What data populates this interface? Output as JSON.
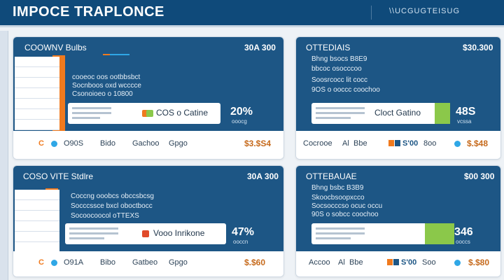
{
  "app": {
    "title": "IMPOCE TRAPLONCE",
    "right_label": "\\\\UCGUGTEISUG"
  },
  "cards": [
    {
      "title": "COOWNV Bulbs",
      "value": "30A 300",
      "lines": [
        "cooeoc oos ootbbsbct",
        "Socnboos oxd wcccce",
        "Csonoioeo o 10800"
      ],
      "inner_label": "COS o Catine",
      "pct": "20%",
      "pct_sub": "ooocg",
      "footer": [
        "C",
        "O90S",
        "Bido",
        "Gachoo",
        "Gpgo"
      ],
      "money": "$3.$S4"
    },
    {
      "title": "OTTEDIAIS",
      "value": "$30.300",
      "lines": [
        "Bhng bsocs B8E9",
        "bbcoc osocccoo",
        "Soosrcocc lit cocc",
        "9OS o ooccc coochoo"
      ],
      "inner_label": "Cloct Gatino",
      "pct": "48S",
      "pct_sub": "vcssa",
      "footer": [
        "Cocrooe",
        "Al",
        "Bbe",
        "S'00",
        "8oo"
      ],
      "money": "$.$48"
    },
    {
      "title": "COSO VITE Stdlre",
      "value": "30A 300",
      "lines": [
        "Coccng ooobcs obccsbcsg",
        "Socccssce bxcl oboctbocc",
        "Socoocoocol oTTEXS"
      ],
      "inner_label": "Vooo Inrikone",
      "pct": "47%",
      "pct_sub": "ooccn",
      "footer": [
        "C",
        "O91A",
        "Bibo",
        "Gatbeo",
        "Gpgo"
      ],
      "money": "$.$60"
    },
    {
      "title": "OTTEBAUAE",
      "value": "$00 300",
      "lines": [
        "Bhng bsbc B3B9",
        "Skoocbsoopxcco",
        "Socsocccso ocuc occu",
        "90S o sobcc coochoo"
      ],
      "inner_label": "",
      "pct": "346",
      "pct_sub": "ooccs",
      "footer": [
        "Accoo",
        "Al",
        "Bbe",
        "S'00",
        "Soo"
      ],
      "money": "$.$80"
    }
  ],
  "colors": {
    "header": "#1d5685",
    "topbar": "#0f4a7a",
    "accent": "#f07a1e",
    "green": "#8bc84a",
    "money": "#c66a1c"
  },
  "icons": [
    "card-accent-icon",
    "status-dot-icon",
    "chart-square-icon"
  ]
}
